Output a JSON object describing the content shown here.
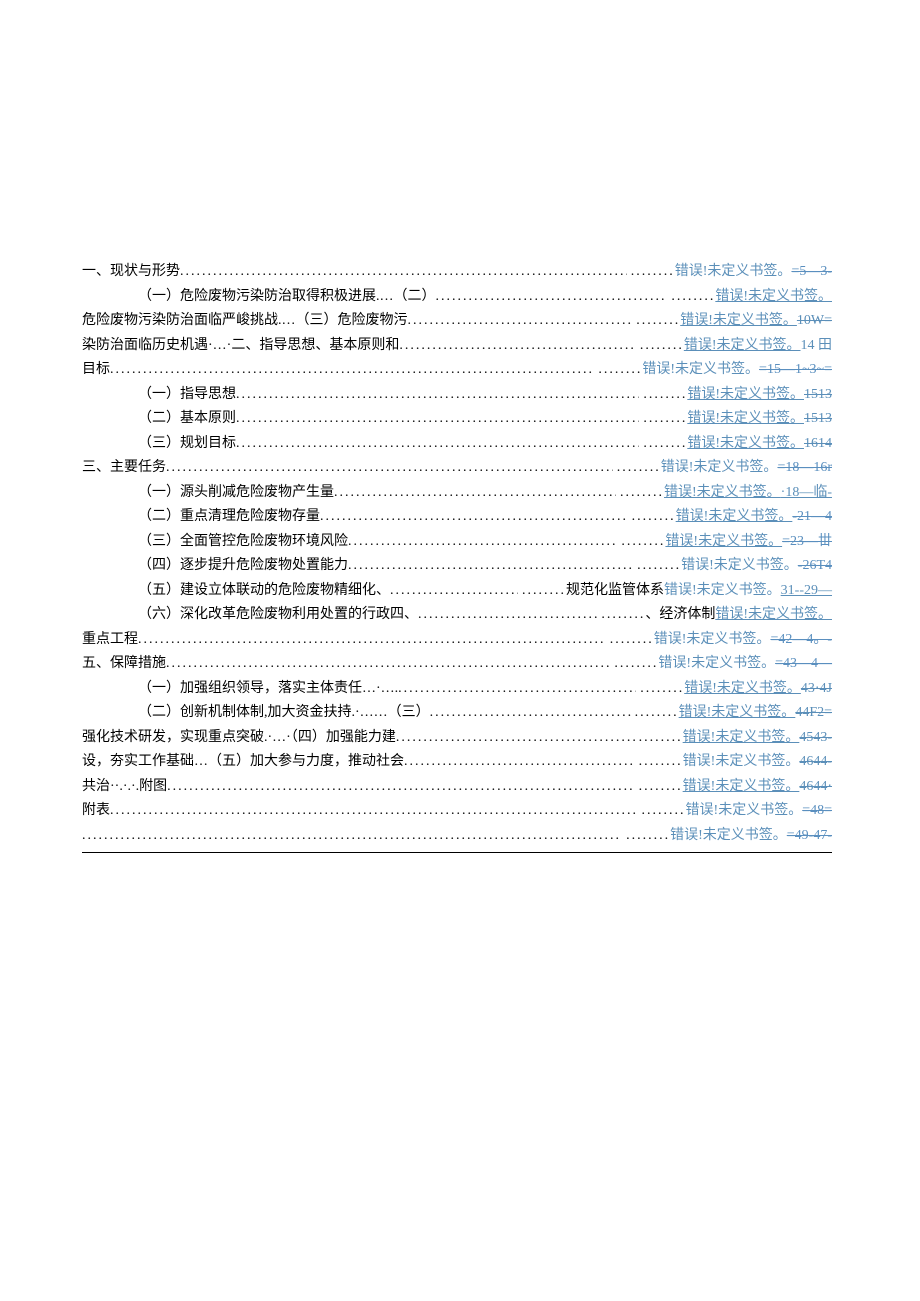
{
  "rows": [
    {
      "left": "一、现状与形势",
      "indent": 0,
      "err": "错误!未定义书签。",
      "tail": "=5—3-",
      "tail_cls": "strike lnk"
    },
    {
      "left": "（一）危险废物污染防治取得积极进展.…（二）",
      "indent": 1,
      "err": "错误!未定义书签。",
      "err_u": true,
      "tail": "",
      "tail_cls": ""
    },
    {
      "left": "危险废物污染防治面临严峻挑战.…（三）危险废物污",
      "indent": 0,
      "err": "错误!未定义书签。",
      "err_u": true,
      "tail": "10W=",
      "tail_cls": "strike"
    },
    {
      "left": "染防治面临历史机遇·…·二、指导思想、基本原则和",
      "indent": 0,
      "err": "错误!未定义书签。",
      "err_u": true,
      "tail": "14 田",
      "tail_cls": ""
    },
    {
      "left": "目标",
      "indent": 0,
      "err": "错误!未定义书签。",
      "tail": "=15—1~3~=",
      "tail_cls": "strike lnk"
    },
    {
      "left": "（一）指导思想",
      "indent": 1,
      "err": "错误!未定义书签。",
      "err_u": true,
      "tail": "1513",
      "tail_cls": "strike"
    },
    {
      "left": "（二）基本原则",
      "indent": 1,
      "err": "错误!未定义书签。",
      "err_u": true,
      "tail": "1513",
      "tail_cls": "strike"
    },
    {
      "left": "（三）规划目标",
      "indent": 1,
      "err": "错误!未定义书签。",
      "err_u": true,
      "tail": "1614",
      "tail_cls": "strike"
    },
    {
      "left": "三、主要任务",
      "indent": 0,
      "err": "错误!未定义书签。",
      "tail": "=18—16r",
      "tail_cls": "strike lnk"
    },
    {
      "left": "（一）源头削减危险废物产生量",
      "indent": 1,
      "err": "错误!未定义书签。",
      "err_u": true,
      "tail": "·18—临-",
      "tail_cls": "u"
    },
    {
      "left": "（二）重点清理危险废物存量",
      "indent": 1,
      "err": "错误!未定义书签。",
      "err_u": true,
      "tail": "-21—4",
      "tail_cls": "strike lnk"
    },
    {
      "left": "（三）全面管控危险废物环境风险",
      "indent": 1,
      "err": "错误!未定义书签。",
      "err_u": true,
      "tail": "=23—丗",
      "tail_cls": "strike lnk"
    },
    {
      "left": "（四）逐步提升危险废物处置能力",
      "indent": 1,
      "err": "错误!未定义书签。",
      "tail": "-26T4",
      "tail_cls": "strike lnk"
    },
    {
      "left": "（五）建设立体联动的危险废物精细化、",
      "indent": 1,
      "mid": "规范化监管体系",
      "err": "错误!未定义书签。",
      "tail": "31--29—",
      "tail_cls": "strike u"
    },
    {
      "left": "（六）深化改革危险废物利用处置的行政四、",
      "indent": 1,
      "mid": "、经济体制",
      "err": "错误!未定义书签。",
      "err_u": true,
      "tail": "",
      "tail_cls": ""
    },
    {
      "left": "重点工程",
      "indent": 0,
      "err": "错误!未定义书签。",
      "tail": "=42—4。-",
      "tail_cls": "strike lnk"
    },
    {
      "left": "五、保障措施",
      "indent": 0,
      "err": "错误!未定义书签。",
      "tail": "=43—4—",
      "tail_cls": "strike lnk"
    },
    {
      "left": "（一）加强组织领导，落实主体责任…·….",
      "indent": 1,
      "err": "错误!未定义书签。",
      "err_u": true,
      "tail": "43·4J",
      "tail_cls": "strike"
    },
    {
      "left": "（二）创新机制体制,加大资金扶持.·……（三）",
      "indent": 1,
      "err": "错误!未定义书签。",
      "err_u": true,
      "tail": "44F2=",
      "tail_cls": "strike"
    },
    {
      "left": "强化技术研发，实现重点突破.·…·（四）加强能力建",
      "indent": 0,
      "err": "错误!未定义书签。",
      "err_u": true,
      "tail": "4543-",
      "tail_cls": "strike"
    },
    {
      "left": "设，夯实工作基础…（五）加大参与力度，推动社会",
      "indent": 0,
      "err": "错误!未定义书签。",
      "tail": "4644-",
      "tail_cls": "strike"
    },
    {
      "left": "共治··.·.·.附图",
      "indent": 0,
      "err": "错误!未定义书签。",
      "err_u": true,
      "tail": "4644·",
      "tail_cls": "strike"
    },
    {
      "left": "附表",
      "indent": 0,
      "err": "错误!未定义书签。",
      "tail": "=48=",
      "tail_cls": "strike lnk"
    },
    {
      "left": "",
      "indent": 0,
      "err": "错误!未定义书签。",
      "tail": "=49-47-",
      "tail_cls": "strike lnk"
    }
  ]
}
